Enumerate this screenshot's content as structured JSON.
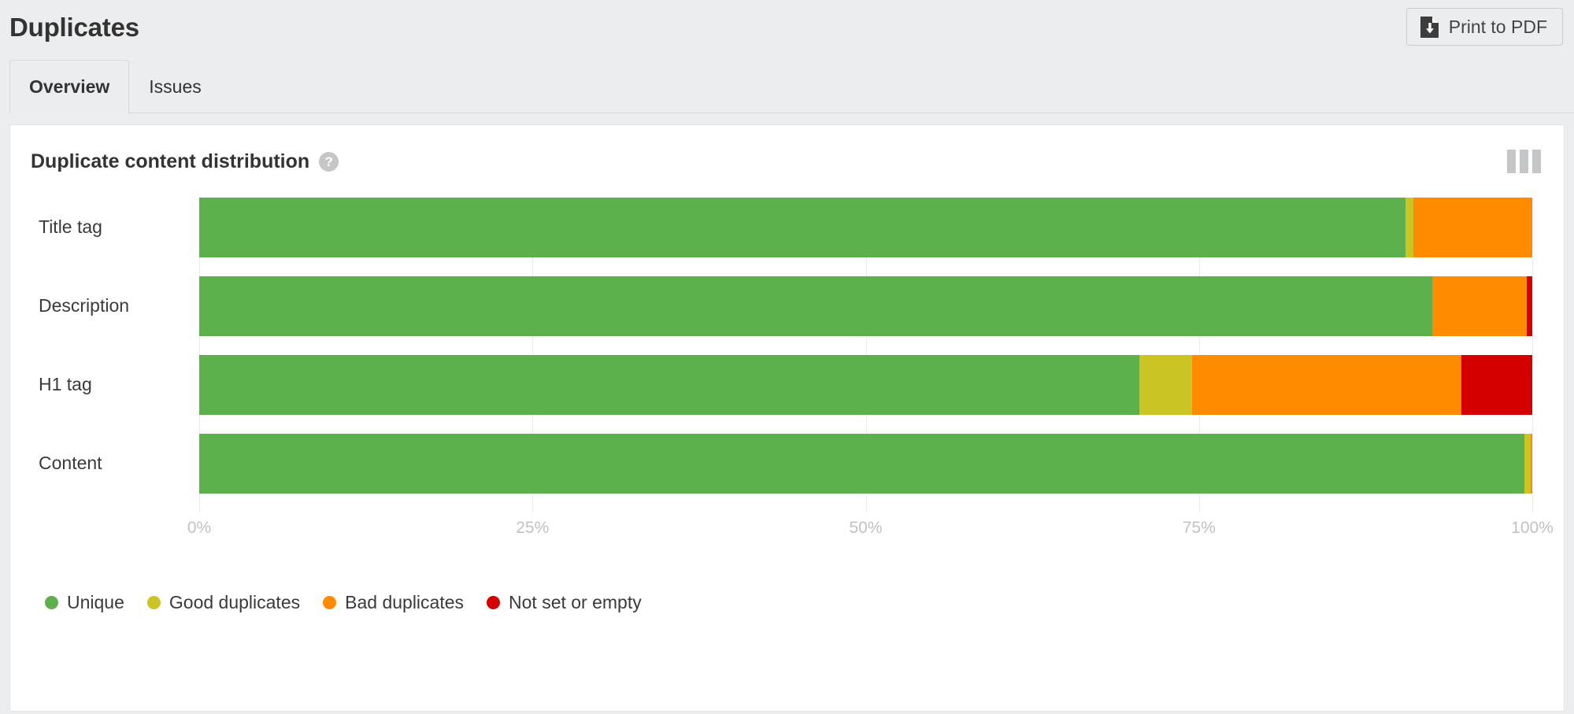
{
  "header": {
    "title": "Duplicates",
    "print_button": {
      "label": "Print to PDF",
      "icon": "document-download-icon"
    }
  },
  "tabs": [
    {
      "label": "Overview",
      "active": true
    },
    {
      "label": "Issues",
      "active": false
    }
  ],
  "card": {
    "title": "Duplicate content distribution",
    "help_icon": "?",
    "columns_icon": "columns-icon"
  },
  "chart_data": {
    "type": "bar",
    "orientation": "horizontal",
    "stacked": true,
    "stack_mode": "percent",
    "title": "Duplicate content distribution",
    "xlabel": "",
    "ylabel": "",
    "xlim": [
      0,
      100
    ],
    "grid": true,
    "legend_position": "bottom-left",
    "xticks": [
      "0%",
      "25%",
      "50%",
      "75%",
      "100%"
    ],
    "xtick_values": [
      0,
      25,
      50,
      75,
      100
    ],
    "categories": [
      "Title tag",
      "Description",
      "H1 tag",
      "Content"
    ],
    "series": [
      {
        "name": "Unique",
        "color": "#5cb14d",
        "values": [
          90.5,
          92.5,
          70.5,
          99.4
        ]
      },
      {
        "name": "Good duplicates",
        "color": "#cbc425",
        "values": [
          0.6,
          0.0,
          4.0,
          0.5
        ]
      },
      {
        "name": "Bad duplicates",
        "color": "#ff8c00",
        "values": [
          8.9,
          7.1,
          20.2,
          0.1
        ]
      },
      {
        "name": "Not set or empty",
        "color": "#d40000",
        "values": [
          0.0,
          0.4,
          5.3,
          0.0
        ]
      }
    ],
    "legend": [
      {
        "label": "Unique",
        "color": "#5cb14d"
      },
      {
        "label": "Good duplicates",
        "color": "#cbc425"
      },
      {
        "label": "Bad duplicates",
        "color": "#ff8c00"
      },
      {
        "label": "Not set or empty",
        "color": "#d40000"
      }
    ]
  },
  "colors": {
    "page_background": "#ebedef",
    "card_background": "#ffffff",
    "text": "#333333",
    "axis_label": "#c0c2c4",
    "gridline": "#ededed"
  }
}
